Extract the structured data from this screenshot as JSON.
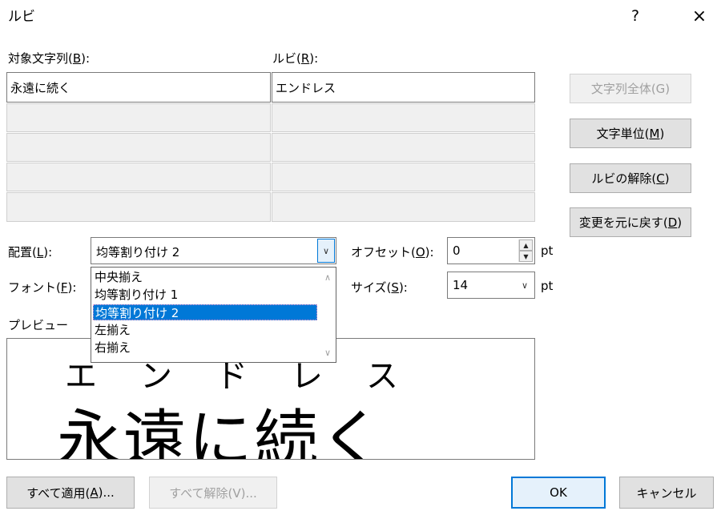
{
  "dialog": {
    "title": "ルビ",
    "help": "?",
    "close": "×"
  },
  "labels": {
    "target_prefix": "対象文字列(",
    "target_key": "B",
    "target_suffix": "):",
    "ruby_prefix": "ルビ(",
    "ruby_key": "R",
    "ruby_suffix": "):"
  },
  "grid": {
    "base_1": "永遠に続く",
    "ruby_1": "エンドレス"
  },
  "right_buttons": {
    "whole": "文字列全体(G)",
    "char_prefix": "文字単位(",
    "char_key": "M",
    "char_suffix": ")",
    "remove_prefix": "ルビの解除(",
    "remove_key": "C",
    "remove_suffix": ")",
    "revert_prefix": "変更を元に戻す(",
    "revert_key": "D",
    "revert_suffix": ")"
  },
  "alignment": {
    "label_prefix": "配置(",
    "label_key": "L",
    "label_suffix": "):",
    "value": "均等割り付け 2",
    "options": [
      "中央揃え",
      "均等割り付け 1",
      "均等割り付け 2",
      "左揃え",
      "右揃え"
    ],
    "selected_index": 2
  },
  "offset": {
    "label_prefix": "オフセット(",
    "label_key": "O",
    "label_suffix": "):",
    "value": "0",
    "unit": "pt"
  },
  "font": {
    "label_prefix": "フォント(",
    "label_key": "F",
    "label_suffix": "):"
  },
  "size": {
    "label_prefix": "サイズ(",
    "label_key": "S",
    "label_suffix": "):",
    "value": "14",
    "unit": "pt"
  },
  "preview": {
    "label": "プレビュー",
    "ruby": "エンドレス",
    "base": "永遠に続く"
  },
  "bottom_buttons": {
    "apply_all_prefix": "すべて適用(",
    "apply_all_key": "A",
    "apply_all_suffix": ")...",
    "remove_all": "すべて解除(V)...",
    "ok": "OK",
    "cancel": "キャンセル"
  },
  "icons": {
    "dropdown": "chevron-down-icon",
    "scroll_up": "scroll-up-icon",
    "scroll_down": "scroll-down-icon",
    "spin_up": "spin-up-icon",
    "spin_down": "spin-down-icon",
    "close": "close-icon",
    "help": "help-icon"
  }
}
